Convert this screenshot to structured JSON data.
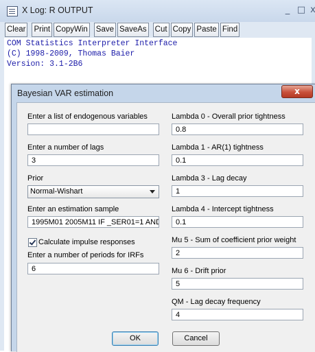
{
  "background_window": {
    "title": "X Log: R OUTPUT",
    "controls": [
      "_",
      "□",
      "x"
    ],
    "toolbar": [
      "Clear",
      "Print",
      "CopyWin",
      "Save",
      "SaveAs",
      "Cut",
      "Copy",
      "Paste",
      "Find"
    ],
    "console_lines": [
      "COM Statistics Interpreter Interface",
      "(C) 1998-2009, Thomas Baier",
      "Version: 3.1-2B6"
    ]
  },
  "dialog": {
    "title": "Bayesian VAR estimation",
    "close_label": "x",
    "left": {
      "endogenous_label": "Enter a list of endogenous variables",
      "endogenous_value": "",
      "lags_label": "Enter a number of lags",
      "lags_value": "3",
      "prior_label": "Prior",
      "prior_value": "Normal-Wishart",
      "sample_label": "Enter an estimation sample",
      "sample_value": "1995M01 2005M11 IF _SER01=1 AND",
      "impulse_checkbox_label": "Calculate impulse responses",
      "impulse_checked": true,
      "irf_periods_label": "Enter a number of periods for IRFs",
      "irf_periods_value": "6"
    },
    "right": [
      {
        "label": "Lambda 0 - Overall prior tightness",
        "value": "0.8"
      },
      {
        "label": "Lambda 1 - AR(1) tightness",
        "value": "0.1"
      },
      {
        "label": "Lambda 3 - Lag decay",
        "value": "1"
      },
      {
        "label": "Lambda 4 - Intercept tightness",
        "value": "0.1"
      },
      {
        "label": "Mu 5 - Sum of coefficient prior weight",
        "value": "2"
      },
      {
        "label": "Mu 6 - Drift prior",
        "value": "5"
      },
      {
        "label": "QM - Lag decay frequency",
        "value": "4"
      }
    ],
    "ok_label": "OK",
    "cancel_label": "Cancel"
  }
}
